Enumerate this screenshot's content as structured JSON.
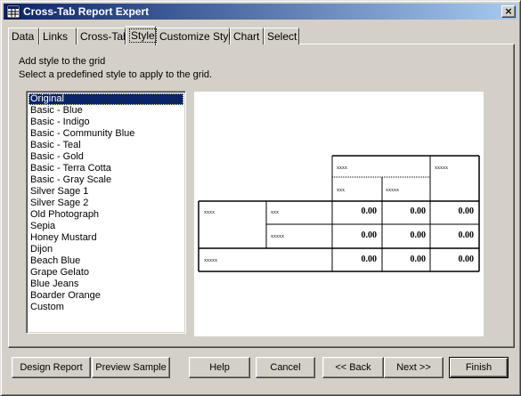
{
  "window": {
    "title": "Cross-Tab Report Expert",
    "close_glyph": "×"
  },
  "tabs": [
    {
      "label": "Data"
    },
    {
      "label": "Links"
    },
    {
      "label": "Cross-Tab"
    },
    {
      "label": "Style",
      "active": true
    },
    {
      "label": "Customize Style"
    },
    {
      "label": "Chart"
    },
    {
      "label": "Select"
    }
  ],
  "instructions": {
    "line1": "Add style to the grid",
    "line2": "Select a predefined style to apply to the grid."
  },
  "styles": {
    "selected": "Original",
    "items": [
      "Original",
      "Basic - Blue",
      "Basic - Indigo",
      "Basic - Community Blue",
      "Basic - Teal",
      "Basic - Gold",
      "Basic - Terra Cotta",
      "Basic - Gray Scale",
      "Silver Sage 1",
      "Silver Sage 2",
      "Old Photograph",
      "Sepia",
      "Honey Mustard",
      "Dijon",
      "Beach Blue",
      "Grape Gelato",
      "Blue Jeans",
      "Boarder Orange",
      "Custom"
    ]
  },
  "preview": {
    "col_group": "xxxx",
    "col_total": "xxxxx",
    "col_a": "xxx",
    "col_b": "xxxxx",
    "row_group": "xxxx",
    "row_a": "xxx",
    "row_b": "xxxxx",
    "row_total": "xxxxx",
    "values": [
      [
        "0.00",
        "0.00",
        "0.00"
      ],
      [
        "0.00",
        "0.00",
        "0.00"
      ],
      [
        "0.00",
        "0.00",
        "0.00"
      ]
    ]
  },
  "buttons": {
    "design_report": "Design Report",
    "preview_sample": "Preview Sample",
    "help": "Help",
    "cancel": "Cancel",
    "back": "<< Back",
    "next": "Next >>",
    "finish": "Finish"
  }
}
